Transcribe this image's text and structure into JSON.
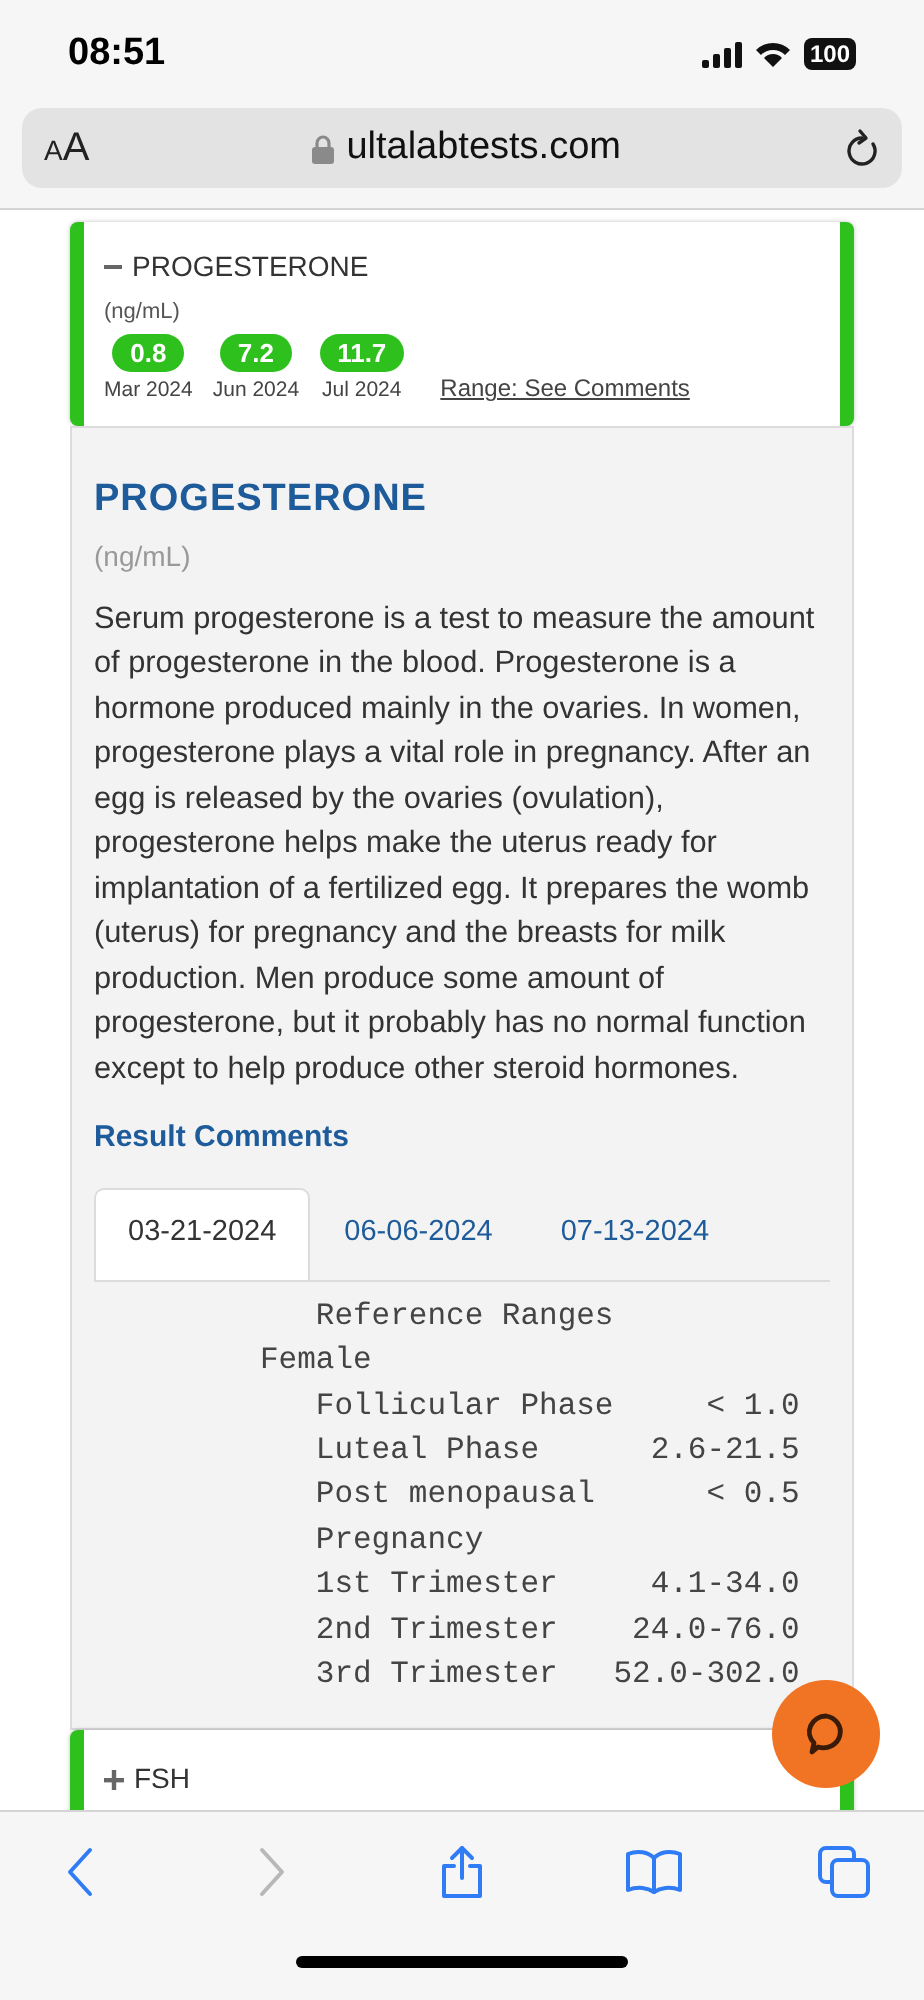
{
  "status_bar": {
    "time": "08:51",
    "battery": "100"
  },
  "address_bar": {
    "text_size": "AA",
    "url": "ultalabtests.com"
  },
  "summary_card": {
    "expanded": true,
    "name": "PROGESTERONE",
    "unit": "(ng/mL)",
    "results": [
      {
        "value": "0.8",
        "date": "Mar 2024"
      },
      {
        "value": "7.2",
        "date": "Jun 2024"
      },
      {
        "value": "11.7",
        "date": "Jul 2024"
      }
    ],
    "range_link": "Range: See Comments"
  },
  "detail": {
    "title": "PROGESTERONE",
    "unit": "(ng/mL)",
    "description": "Serum progesterone is a test to measure the amount of progesterone in the blood. Progesterone is a hormone produced mainly in the ovaries. In women, progesterone plays a vital role in pregnancy. After an egg is released by the ovaries (ovulation), progesterone helps make the uterus ready for implantation of a fertilized egg. It prepares the womb (uterus) for pregnancy and the breasts for milk production. Men produce some amount of progesterone, but it probably has no normal function except to help produce other steroid hormones.",
    "comments_heading": "Result Comments",
    "tabs": [
      {
        "label": "03-21-2024",
        "selected": true
      },
      {
        "label": "06-06-2024",
        "selected": false
      },
      {
        "label": "07-13-2024",
        "selected": false
      }
    ],
    "comment_lines": [
      "   Reference Ranges",
      "Female",
      "   Follicular Phase     < 1.0",
      "   Luteal Phase      2.6-21.5",
      "   Post menopausal      < 0.5",
      "   Pregnancy",
      "   1st Trimester     4.1-34.0",
      "   2nd Trimester    24.0-76.0",
      "   3rd Trimester   52.0-302.0"
    ]
  },
  "next_card": {
    "expanded": false,
    "name": "FSH"
  },
  "toolbar": [
    {
      "kind": "back",
      "disabled": false
    },
    {
      "kind": "forward",
      "disabled": true
    },
    {
      "kind": "share",
      "disabled": false
    },
    {
      "kind": "bookmarks",
      "disabled": false
    },
    {
      "kind": "tabs",
      "disabled": false
    }
  ]
}
